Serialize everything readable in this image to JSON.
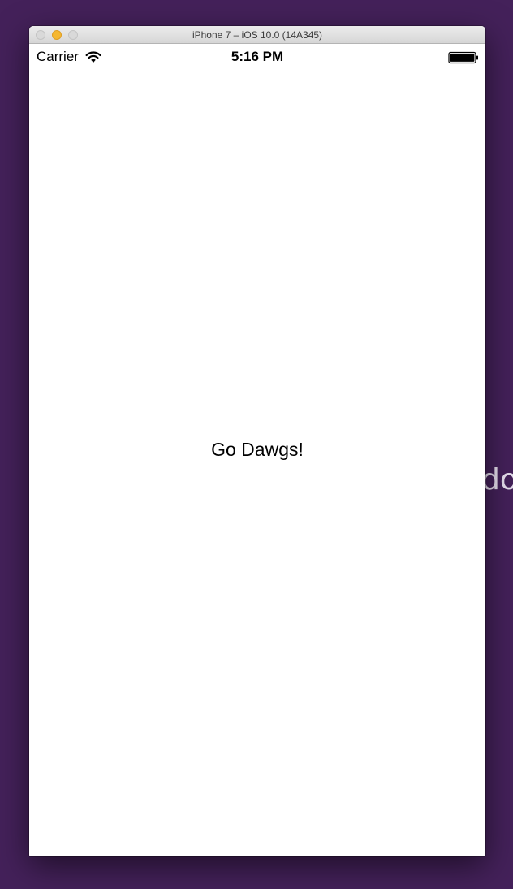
{
  "background": {
    "color": "#44215a",
    "peek_text": "do"
  },
  "window": {
    "title": "iPhone 7 – iOS 10.0 (14A345)",
    "controls": [
      "close",
      "minimize",
      "zoom"
    ]
  },
  "status_bar": {
    "carrier": "Carrier",
    "time": "5:16 PM",
    "icons": [
      "wifi-icon",
      "battery-icon"
    ]
  },
  "screen": {
    "label": "Go Dawgs!"
  }
}
